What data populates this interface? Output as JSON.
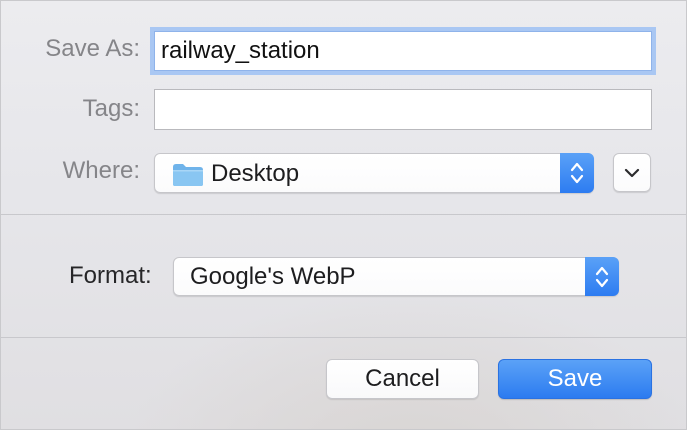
{
  "save_as": {
    "label": "Save As:",
    "value": "railway_station"
  },
  "tags": {
    "label": "Tags:",
    "value": ""
  },
  "where": {
    "label": "Where:",
    "selected": "Desktop",
    "folder_icon": "folder-icon"
  },
  "format": {
    "label": "Format:",
    "selected": "Google's WebP"
  },
  "buttons": {
    "cancel": "Cancel",
    "save": "Save"
  },
  "colors": {
    "accent": "#2d7cf1",
    "focus_ring": "#a9c7f3"
  }
}
